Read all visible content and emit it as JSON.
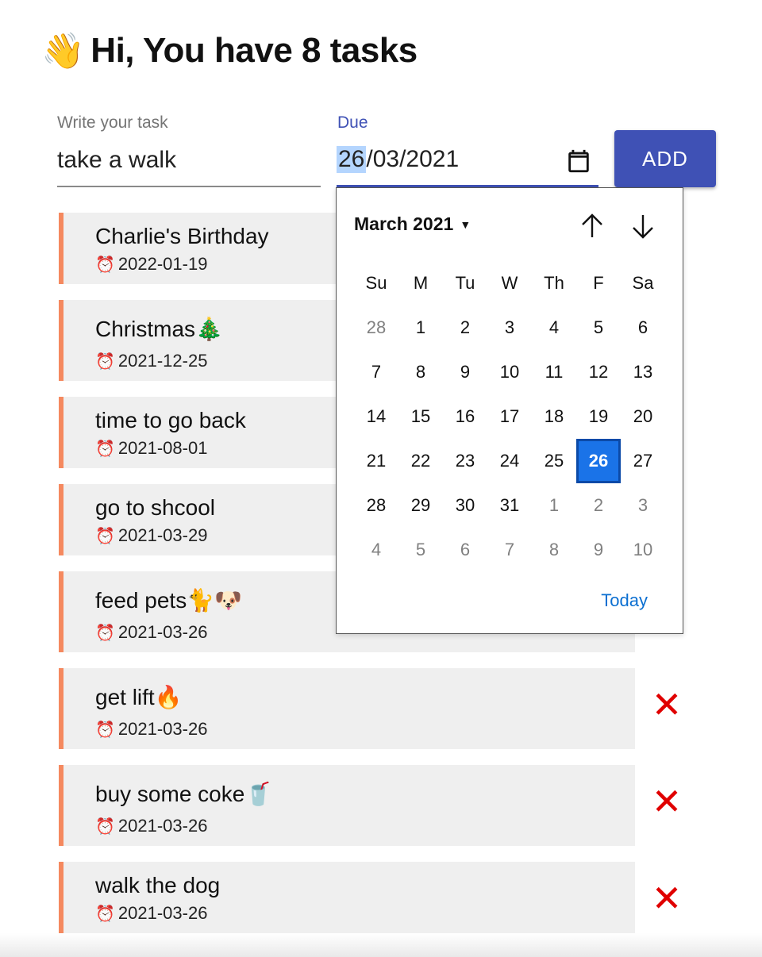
{
  "header": {
    "emoji": "👋",
    "title": "Hi, You have 8 tasks"
  },
  "form": {
    "task_label": "Write your task",
    "task_value": "take a walk",
    "due_label": "Due",
    "due_day": "26",
    "due_rest": "/03/2021",
    "add_label": "ADD"
  },
  "tasks": [
    {
      "title": "Charlie's Birthday",
      "date": "2022-01-19"
    },
    {
      "title": "Christmas🎄",
      "date": "2021-12-25"
    },
    {
      "title": "time to go back",
      "date": "2021-08-01"
    },
    {
      "title": "go to shcool",
      "date": "2021-03-29"
    },
    {
      "title": "feed pets🐈🐶",
      "date": "2021-03-26"
    },
    {
      "title": "get lift🔥",
      "date": "2021-03-26"
    },
    {
      "title": "buy some coke🥤",
      "date": "2021-03-26"
    },
    {
      "title": "walk the dog",
      "date": "2021-03-26"
    }
  ],
  "task_icons": {
    "clock": "⏰",
    "delete": "✕"
  },
  "calendar": {
    "month_label": "March 2021",
    "weekdays": [
      "Su",
      "M",
      "Tu",
      "W",
      "Th",
      "F",
      "Sa"
    ],
    "days": [
      "28",
      "1",
      "2",
      "3",
      "4",
      "5",
      "6",
      "7",
      "8",
      "9",
      "10",
      "11",
      "12",
      "13",
      "14",
      "15",
      "16",
      "17",
      "18",
      "19",
      "20",
      "21",
      "22",
      "23",
      "24",
      "25",
      "26",
      "27",
      "28",
      "29",
      "30",
      "31",
      "1",
      "2",
      "3",
      "4",
      "5",
      "6",
      "7",
      "8",
      "9",
      "10"
    ],
    "other_month_indices": [
      0,
      32,
      33,
      34,
      35,
      36,
      37,
      38,
      39,
      40,
      41
    ],
    "selected_index": 26,
    "today_label": "Today"
  },
  "colors": {
    "accent": "#3f51b5",
    "task_border": "#f5895f",
    "delete": "#e00000",
    "selected_day": "#1a73e8"
  }
}
